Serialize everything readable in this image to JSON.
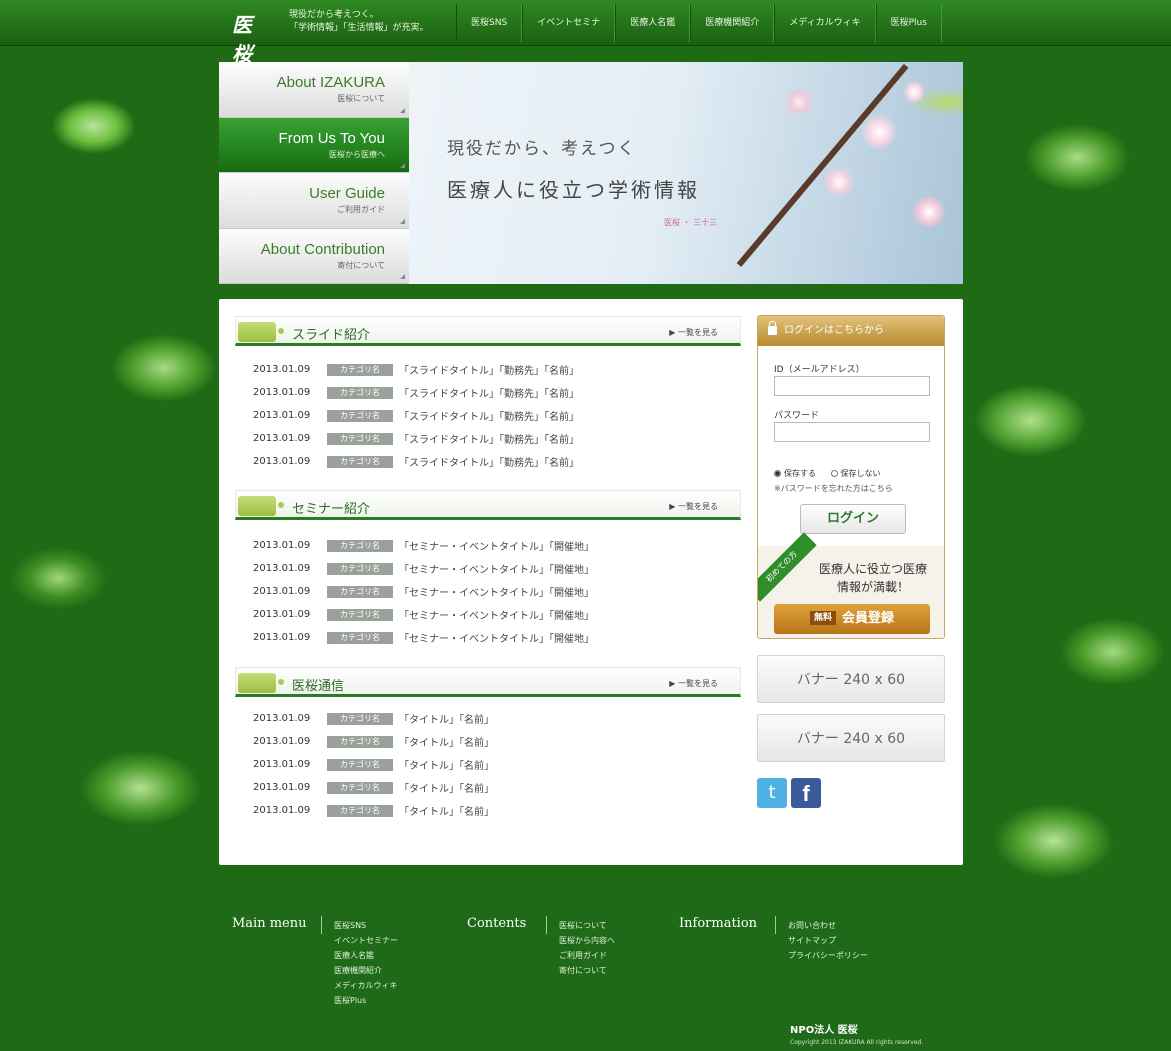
{
  "topbar": {
    "logo": "医桜",
    "tagline": [
      "現役だから考えつく。",
      "「学術情報」「生活情報」が充実。"
    ],
    "nav": [
      "医桜SNS",
      "イベントセミナ",
      "医療人名鑑",
      "医療機関紹介",
      "メディカルウィキ",
      "医桜Plus"
    ]
  },
  "hero": {
    "sidenav": [
      {
        "en": "About IZAKURA",
        "jp": "医桜について",
        "active": false
      },
      {
        "en": "From Us To You",
        "jp": "医桜から医療へ",
        "active": true
      },
      {
        "en": "User Guide",
        "jp": "ご利用ガイド",
        "active": false
      },
      {
        "en": "About Contribution",
        "jp": "寄付について",
        "active": false
      }
    ],
    "line1": "現役だから、考えつく",
    "line2": "医療人に役立つ学術情報",
    "sig": "医桜 ・ 三十三"
  },
  "sections": [
    {
      "title": "スライド紹介",
      "more": "▶ 一覧を見る",
      "rows": [
        {
          "date": "2013.01.09",
          "cat": "カテゴリ名",
          "text": "「スライドタイトル」「勤務先」「名前」"
        },
        {
          "date": "2013.01.09",
          "cat": "カテゴリ名",
          "text": "「スライドタイトル」「勤務先」「名前」"
        },
        {
          "date": "2013.01.09",
          "cat": "カテゴリ名",
          "text": "「スライドタイトル」「勤務先」「名前」"
        },
        {
          "date": "2013.01.09",
          "cat": "カテゴリ名",
          "text": "「スライドタイトル」「勤務先」「名前」"
        },
        {
          "date": "2013.01.09",
          "cat": "カテゴリ名",
          "text": "「スライドタイトル」「勤務先」「名前」"
        }
      ]
    },
    {
      "title": "セミナー紹介",
      "more": "▶ 一覧を見る",
      "rows": [
        {
          "date": "2013.01.09",
          "cat": "カテゴリ名",
          "text": "「セミナー・イベントタイトル」「開催地」"
        },
        {
          "date": "2013.01.09",
          "cat": "カテゴリ名",
          "text": "「セミナー・イベントタイトル」「開催地」"
        },
        {
          "date": "2013.01.09",
          "cat": "カテゴリ名",
          "text": "「セミナー・イベントタイトル」「開催地」"
        },
        {
          "date": "2013.01.09",
          "cat": "カテゴリ名",
          "text": "「セミナー・イベントタイトル」「開催地」"
        },
        {
          "date": "2013.01.09",
          "cat": "カテゴリ名",
          "text": "「セミナー・イベントタイトル」「開催地」"
        }
      ]
    },
    {
      "title": "医桜通信",
      "more": "▶ 一覧を見る",
      "rows": [
        {
          "date": "2013.01.09",
          "cat": "カテゴリ名",
          "text": "「タイトル」「名前」"
        },
        {
          "date": "2013.01.09",
          "cat": "カテゴリ名",
          "text": "「タイトル」「名前」"
        },
        {
          "date": "2013.01.09",
          "cat": "カテゴリ名",
          "text": "「タイトル」「名前」"
        },
        {
          "date": "2013.01.09",
          "cat": "カテゴリ名",
          "text": "「タイトル」「名前」"
        },
        {
          "date": "2013.01.09",
          "cat": "カテゴリ名",
          "text": "「タイトル」「名前」"
        }
      ]
    }
  ],
  "login": {
    "header": "ログインはこちらから",
    "id_label": "ID（メールアドレス）",
    "pw_label": "パスワード",
    "save_yes": "保存する",
    "save_no": "保存しない",
    "forgot": "※パスワードを忘れた方はこちら",
    "button": "ログイン",
    "ribbon": "初めての方",
    "reg_text": "医療人に役立つ医療情報が満載！",
    "reg_free": "無料",
    "reg_button": "会員登録"
  },
  "banners": [
    "バナー 240 x 60",
    "バナー 240 x 60"
  ],
  "social": {
    "twitter": "t",
    "facebook": "f"
  },
  "footer": {
    "cols": [
      {
        "head": "Main menu",
        "links": [
          "医桜SNS",
          "イベントセミナー",
          "医療人名鑑",
          "医療機関紹介",
          "メディカルウィキ",
          "医桜Plus"
        ]
      },
      {
        "head": "Contents",
        "links": [
          "医桜について",
          "医桜から内容へ",
          "ご利用ガイド",
          "寄付について"
        ]
      },
      {
        "head": "Information",
        "links": [
          "お問い合わせ",
          "サイトマップ",
          "プライバシーポリシー"
        ]
      }
    ],
    "org": "NPO法人 医桜",
    "copyright": "Copyright 2013 IZAKURA All rights reserved."
  }
}
